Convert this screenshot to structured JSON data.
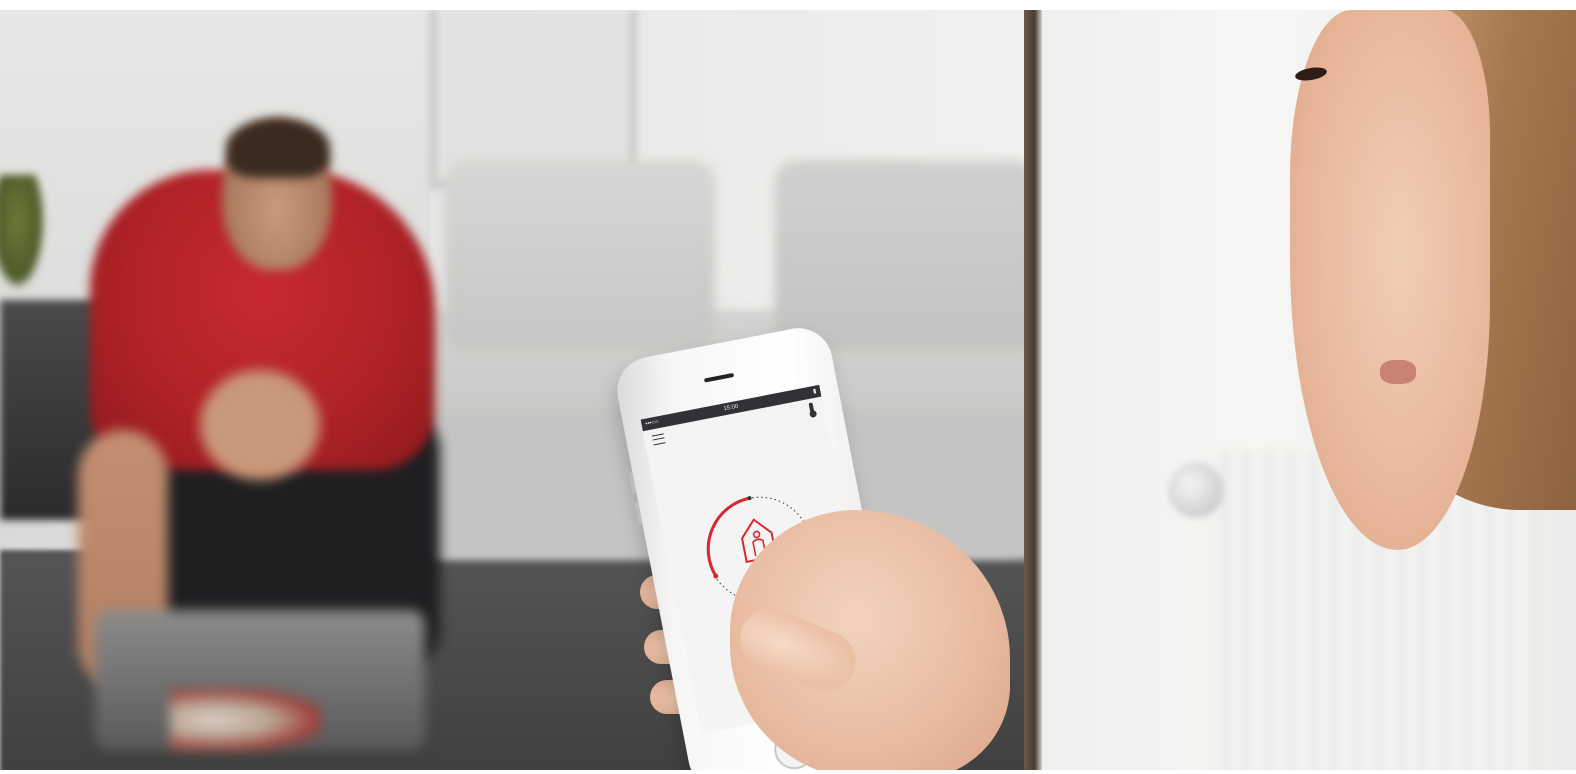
{
  "scene": {
    "description_tags": [
      "photo-background",
      "person-with-phone",
      "blurred-room"
    ]
  },
  "app": {
    "status_bar": {
      "signal": "•••○○",
      "time": "15:00",
      "battery": "▮"
    },
    "mode_label": "At Home",
    "icons": {
      "menu": "menu-icon",
      "thermometer": "thermometer-icon",
      "home": "home-person-icon"
    },
    "accent_color": "#d6282f"
  }
}
